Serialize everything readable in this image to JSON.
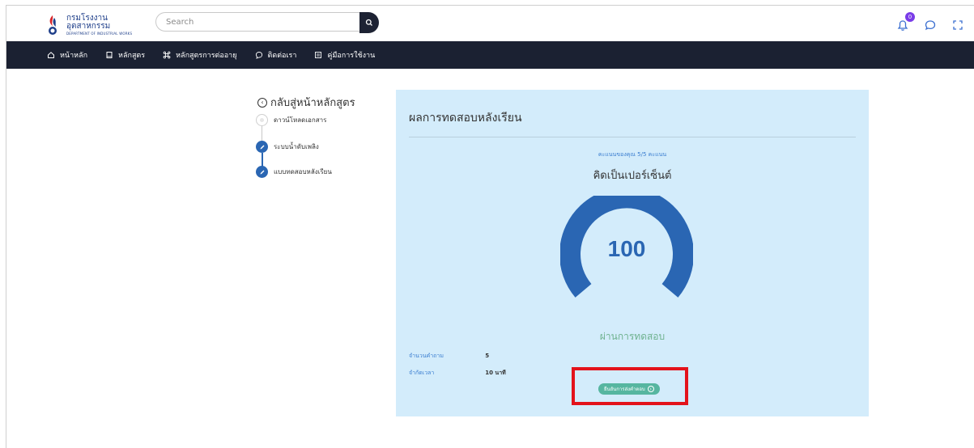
{
  "header": {
    "logo_th": "กรมโรงงานอุตสาหกรรม",
    "logo_en": "DEPARTMENT OF INDUSTRIAL WORKS",
    "search_placeholder": "Search",
    "notification_count": "0"
  },
  "nav": {
    "items": [
      {
        "label": "หน้าหลัก",
        "icon": "home-icon"
      },
      {
        "label": "หลักสูตร",
        "icon": "book-icon"
      },
      {
        "label": "หลักสูตรการต่ออายุ",
        "icon": "command-icon"
      },
      {
        "label": "ติดต่อเรา",
        "icon": "chat-icon"
      },
      {
        "label": "คู่มือการใช้งาน",
        "icon": "manual-icon"
      }
    ]
  },
  "sidebar": {
    "back_label": "กลับสู่หน้าหลักสูตร",
    "steps": [
      {
        "label": "ดาวน์โหลดเอกสาร",
        "status": "pending"
      },
      {
        "label": "ระบบน้ำดับเพลิง",
        "status": "done"
      },
      {
        "label": "แบบทดสอบหลังเรียน",
        "status": "done"
      }
    ]
  },
  "result": {
    "title": "ผลการทดสอบหลังเรียน",
    "score_line": "คะแนนของคุณ 5/5 คะแนน",
    "percent_label": "คิดเป็นเปอร์เซ็นต์",
    "percent_value": "100",
    "status": "ผ่านการทดสอบ",
    "question_count_label": "จำนวนคำถาม",
    "question_count_value": "5",
    "time_limit_label": "จำกัดเวลา",
    "time_limit_value": "10 นาที",
    "submit_label": "ยืนยันการส่งคำตอบ"
  },
  "colors": {
    "nav_bg": "#1b2132",
    "panel_bg": "#d3ecfb",
    "gauge": "#2a66b3",
    "pass": "#6fb28f",
    "submit": "#56b6a0",
    "highlight": "#e3131b"
  }
}
